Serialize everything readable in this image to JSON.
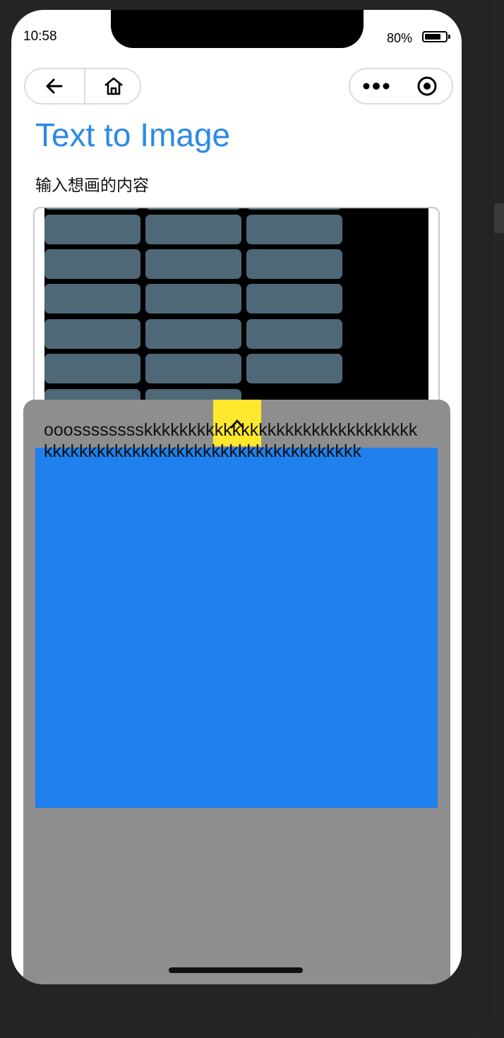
{
  "status_bar": {
    "time": "10:58",
    "battery_text": "80%",
    "battery_level": 0.8
  },
  "nav": {
    "back_icon": "arrow-left-icon",
    "home_icon": "home-icon",
    "more_icon": "more-dots-icon",
    "close_icon": "record-circle-icon"
  },
  "page": {
    "title": "Text to Image",
    "input_label": "输入想画的内容"
  },
  "input_sheet": {
    "text": "ooosssssssskkkkkkkkkkkkkkkkkkkkkkkkkkkkkkkkkkkkkkkkkkkkkkkkkkkkkkkkkkkkkkkkkkk",
    "toggle_icon": "chevron-up-icon"
  },
  "colors": {
    "title": "#2b8ae6",
    "grid_button": "#4e6878",
    "sheet_background": "#8e8e8e",
    "blue_panel": "#1f80ee",
    "toggle_background": "#ffe82e"
  }
}
